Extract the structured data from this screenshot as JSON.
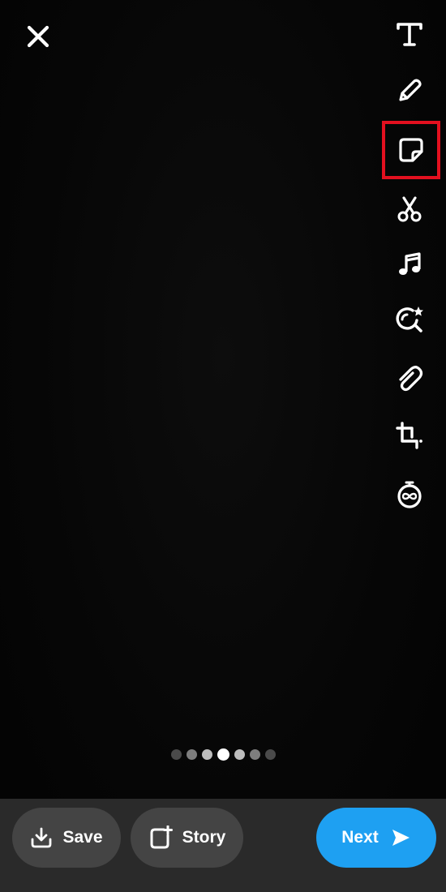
{
  "colors": {
    "background": "#050505",
    "bottom_bar": "#2a2a2a",
    "pill_gray": "#444444",
    "next_blue": "#1ea0f2",
    "highlight_red": "#e3101f",
    "icon_white": "#ffffff"
  },
  "header": {
    "close_icon": "close-icon"
  },
  "toolbar": {
    "items": [
      {
        "icon": "text-icon"
      },
      {
        "icon": "pencil-icon"
      },
      {
        "icon": "sticker-icon",
        "highlighted": true
      },
      {
        "icon": "scissors-icon"
      },
      {
        "icon": "music-icon"
      },
      {
        "icon": "lens-search-icon"
      },
      {
        "icon": "paperclip-icon"
      },
      {
        "icon": "crop-icon"
      },
      {
        "icon": "timer-infinity-icon"
      }
    ]
  },
  "page_indicator": {
    "count": 7,
    "active_index": 3
  },
  "bottom_bar": {
    "save_label": "Save",
    "story_label": "Story",
    "next_label": "Next"
  }
}
